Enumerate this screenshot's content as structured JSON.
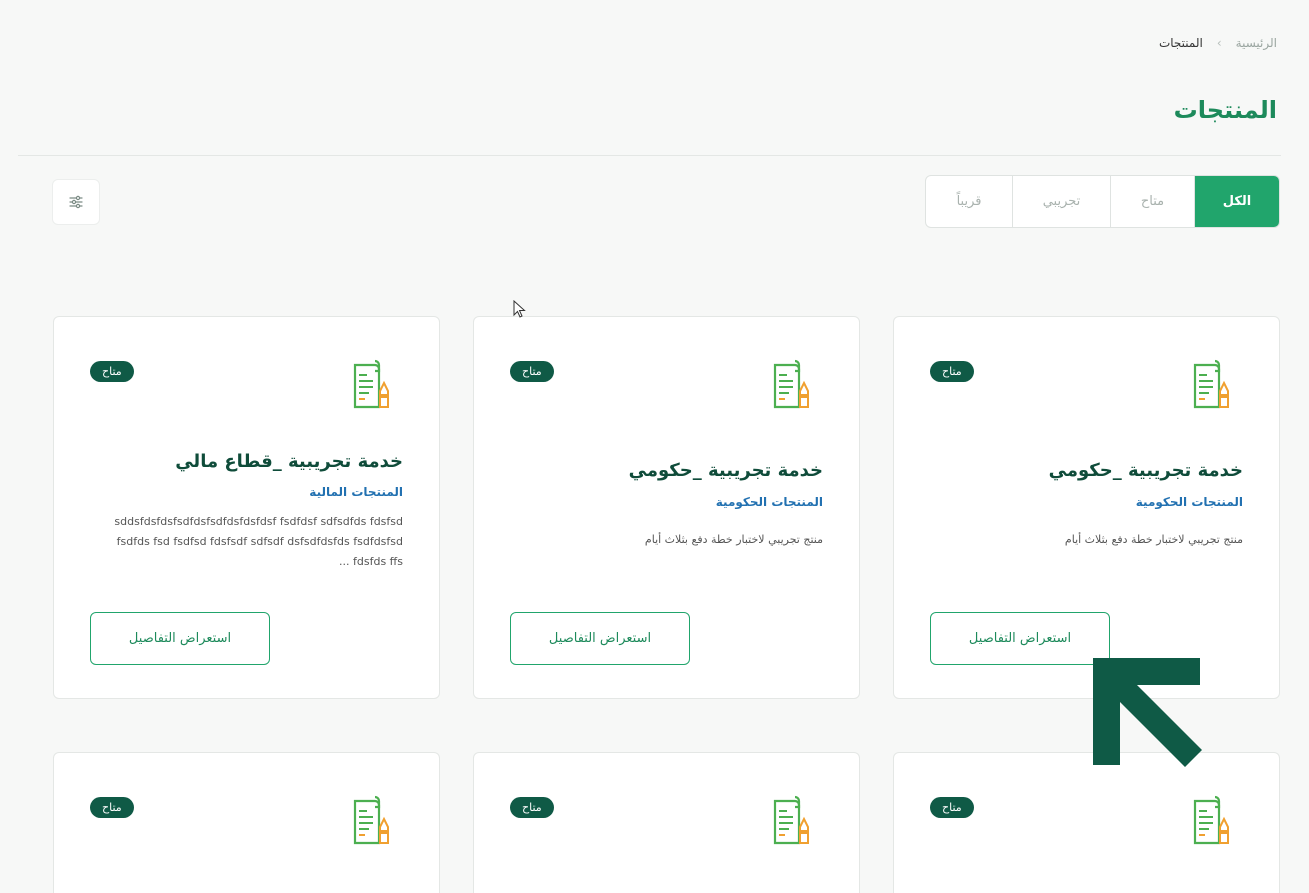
{
  "breadcrumb": {
    "home": "الرئيسية",
    "separator": "›",
    "current": "المنتجات"
  },
  "page_title": "المنتجات",
  "tabs": [
    {
      "label": "الكل",
      "active": true
    },
    {
      "label": "متاح",
      "active": false
    },
    {
      "label": "تجريبي",
      "active": false
    },
    {
      "label": "قريباً",
      "active": false
    }
  ],
  "filter_icon": "sliders-icon",
  "colors": {
    "accent": "#21a56c",
    "badge": "#0f5a46",
    "title": "#0f4c3a",
    "category": "#2271b1"
  },
  "cards": [
    {
      "badge": "متاح",
      "title": "خدمة تجريبية _حكومي",
      "category": "المنتجات الحكومية",
      "description": "منتج تجريبي لاختبار خطة دفع بثلاث أيام",
      "button": "استعراض التفاصيل"
    },
    {
      "badge": "متاح",
      "title": "خدمة تجريبية _حكومي",
      "category": "المنتجات الحكومية",
      "description": "منتج تجريبي لاختبار خطة دفع بثلاث أيام",
      "button": "استعراض التفاصيل"
    },
    {
      "badge": "متاح",
      "title": "خدمة تجريبية _قطاع مالي",
      "category": "المنتجات المالية",
      "description": "sddsfdsfdsfsdfdsfsdfdsfdsfdsf fsdfdsf sdfsdfds fdsfsd fsdfds fsd fsdfsd fdsfsdf sdfsdf dsfsdfdsfds fsdfdsfsd fdsfds ffs ...",
      "button": "استعراض التفاصيل"
    },
    {
      "badge": "متاح"
    },
    {
      "badge": "متاح"
    },
    {
      "badge": "متاح"
    }
  ]
}
